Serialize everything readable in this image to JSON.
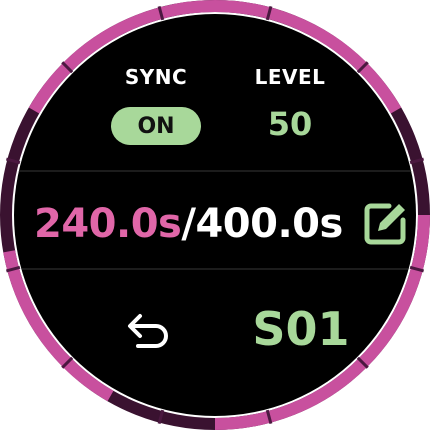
{
  "sync": {
    "label": "SYNC",
    "value": "ON"
  },
  "level": {
    "label": "LEVEL",
    "value": "50"
  },
  "timer": {
    "elapsed": "240.0s",
    "separator": "/",
    "total": "400.0s",
    "progress_fraction": 0.6,
    "edit_icon": "edit-icon"
  },
  "footer": {
    "back_icon": "back-arrow-icon",
    "slot": "S01"
  },
  "colors": {
    "ring_active": "#c8509e",
    "ring_inactive": "#3a1230",
    "ring_tick": "#4b1840",
    "face": "#000000",
    "accent_green": "#a8d89a",
    "accent_pink": "#e066a8",
    "text": "#ffffff"
  }
}
